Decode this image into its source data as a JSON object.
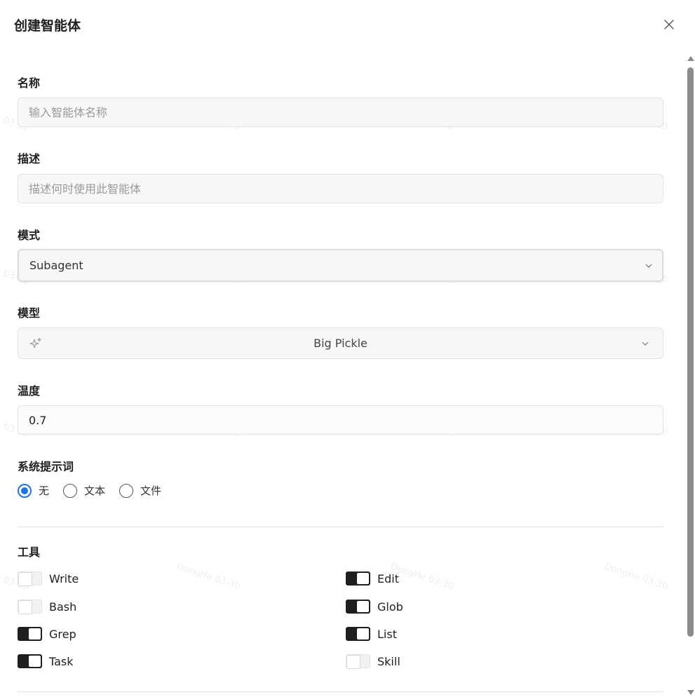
{
  "dialog": {
    "title": "创建智能体"
  },
  "form": {
    "name": {
      "label": "名称",
      "placeholder": "输入智能体名称",
      "value": ""
    },
    "description": {
      "label": "描述",
      "placeholder": "描述何时使用此智能体",
      "value": ""
    },
    "mode": {
      "label": "模式",
      "value": "Subagent"
    },
    "model": {
      "label": "模型",
      "value": "Big Pickle"
    },
    "temperature": {
      "label": "温度",
      "value": "0.7"
    },
    "system_prompt": {
      "label": "系统提示词",
      "options": [
        {
          "label": "无",
          "checked": true
        },
        {
          "label": "文本",
          "checked": false
        },
        {
          "label": "文件",
          "checked": false
        }
      ]
    },
    "tools": {
      "label": "工具",
      "items": [
        {
          "label": "Write",
          "enabled": false
        },
        {
          "label": "Edit",
          "enabled": true
        },
        {
          "label": "Bash",
          "enabled": false
        },
        {
          "label": "Glob",
          "enabled": true
        },
        {
          "label": "Grep",
          "enabled": true
        },
        {
          "label": "List",
          "enabled": true
        },
        {
          "label": "Task",
          "enabled": true
        },
        {
          "label": "Skill",
          "enabled": false
        }
      ]
    }
  },
  "watermark": {
    "text": "DongHe 03-30",
    "fragment": "03-30"
  },
  "colors": {
    "accent": "#1a73e8",
    "switch_on": "#1f1f1f",
    "field_bg": "#f7f7f7"
  },
  "icons": [
    "close-icon",
    "chevron-down-icon",
    "sparkle-icon"
  ]
}
